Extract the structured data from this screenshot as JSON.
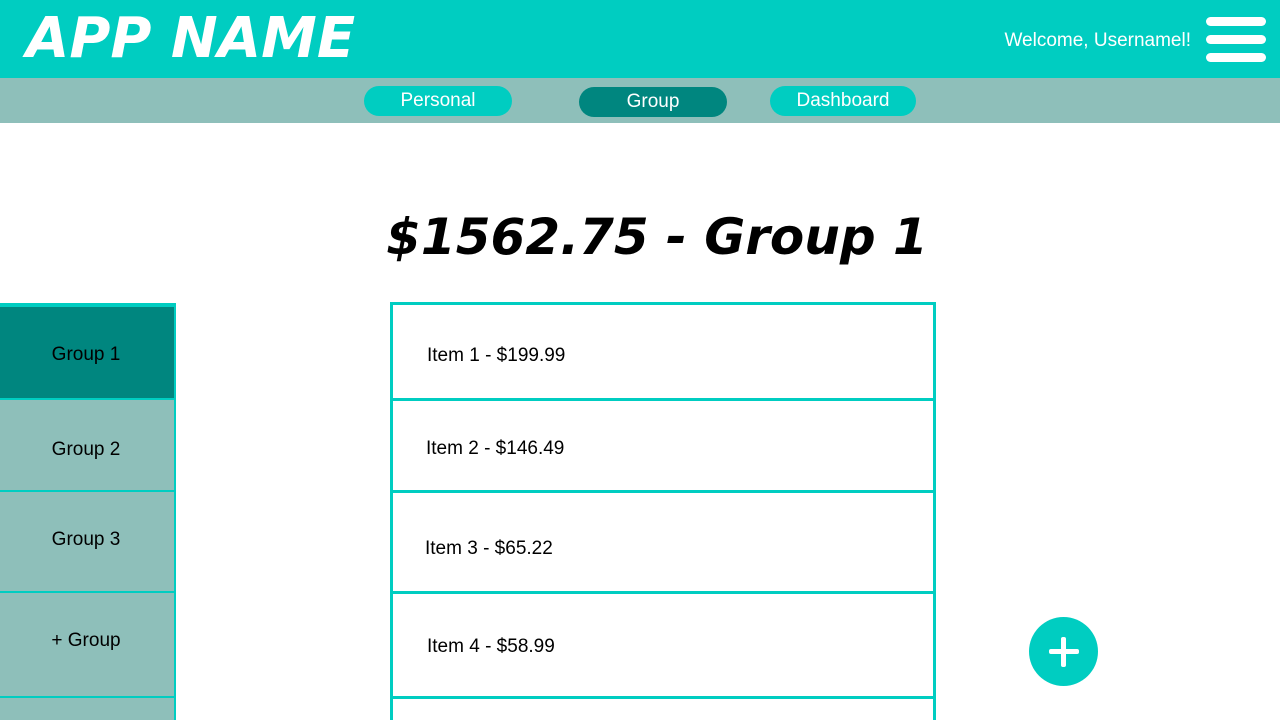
{
  "header": {
    "app_name": "APP NAME",
    "welcome_text": "Welcome, Usernamel!",
    "menu_icon": "hamburger-menu-icon"
  },
  "nav": {
    "tabs": [
      {
        "label": "Personal",
        "active": false
      },
      {
        "label": "Group",
        "active": true
      },
      {
        "label": "Dashboard",
        "active": false
      }
    ]
  },
  "main": {
    "title": "$1562.75 - Group 1"
  },
  "sidebar": {
    "items": [
      {
        "label": "Group 1",
        "active": true
      },
      {
        "label": "Group 2",
        "active": false
      },
      {
        "label": "Group 3",
        "active": false
      },
      {
        "label": "+ Group",
        "active": false
      }
    ]
  },
  "items": [
    {
      "label": "Item 1 - $199.99"
    },
    {
      "label": "Item 2 - $146.49"
    },
    {
      "label": "Item 3 - $65.22"
    },
    {
      "label": "Item 4 - $58.99"
    }
  ],
  "fab": {
    "icon": "plus-icon"
  },
  "colors": {
    "header_bg": "#00cdc1",
    "nav_bg": "#8ebfba",
    "active": "#00867f",
    "accent": "#00cdc1"
  }
}
